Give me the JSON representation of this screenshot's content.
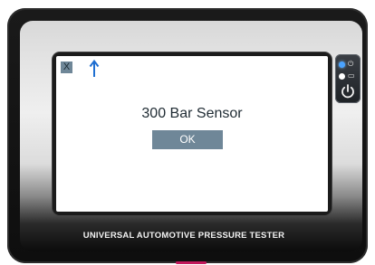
{
  "device": {
    "label": "UNIVERSAL AUTOMOTIVE PRESSURE TESTER"
  },
  "screen": {
    "close_label": "X",
    "arrow_icon": "up-arrow-icon",
    "title": "300 Bar Sensor",
    "ok_label": "OK"
  },
  "side_panel": {
    "indicators": [
      {
        "icon": "bluetooth-status-icon",
        "glyph": "⏻",
        "color": "#4aa3ff"
      },
      {
        "icon": "battery-status-icon",
        "glyph": "▭",
        "color": "#ffffff"
      }
    ],
    "power_icon": "power-icon"
  },
  "colors": {
    "accent": "#6f8798",
    "arrow": "#1f6fd1",
    "text": "#1f2b33",
    "brand_text": "#f2f2f2",
    "bottom_accent": "#c2185b"
  }
}
